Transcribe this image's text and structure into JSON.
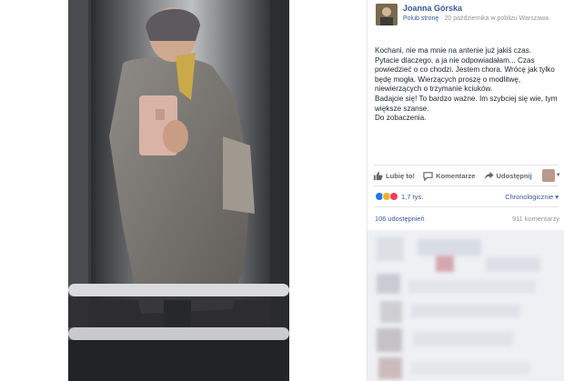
{
  "post": {
    "author": "Joanna Górska",
    "follow_label": "Polub stronę",
    "meta_rest": " · 20 października w pobliżu Warszawa",
    "text_lines": [
      "Kochani, nie ma mnie na antenie już jakiś czas.",
      "Pytacie dlaczego, a ja nie odpowiadałam... Czas powiedzieć o co chodzi. Jestem chora. Wrócę jak tylko będę mogła. Wierzących proszę o modlitwę, niewierzących o trzymanie kciuków.",
      "Badajcie się! To bardzo ważne. Im szybciej się wie, tym większe szanse.",
      "Do zobaczenia."
    ]
  },
  "actions": {
    "like": "Lubię to!",
    "comment": "Komentarze",
    "share": "Udostępnij"
  },
  "reactions": {
    "count": "1,7 tys.",
    "order": "Chronologicznie ▾"
  },
  "stats": {
    "shares": "106 udostępnień",
    "comments": "911 komentarzy"
  },
  "colors": {
    "link": "#385898",
    "text": "#1d2129",
    "muted": "#90949c",
    "photo_bg": "#3b3c3f"
  }
}
